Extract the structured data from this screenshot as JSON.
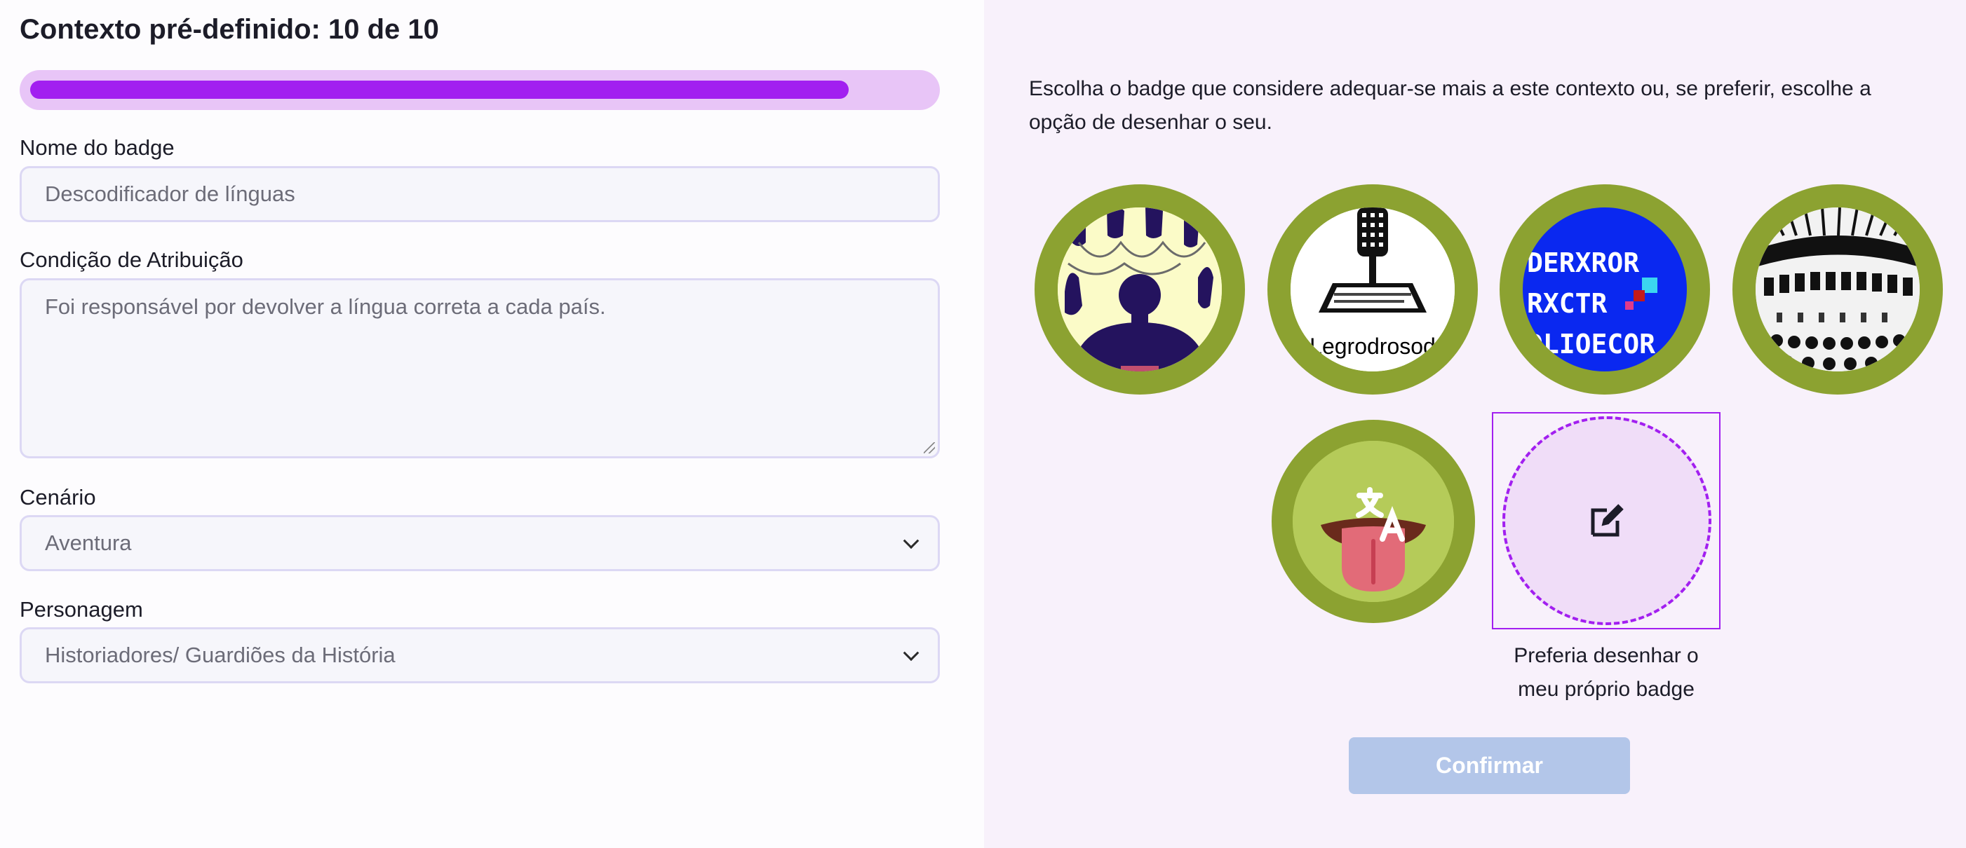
{
  "header": {
    "title": "Contexto pré-definido: 10 de 10"
  },
  "progress": {
    "fraction": 0.91,
    "color": "#a21ff0",
    "track_color": "#e8c5f7"
  },
  "form": {
    "badge_name": {
      "label": "Nome do badge",
      "placeholder": "Descodificador de línguas"
    },
    "condition": {
      "label": "Condição de Atribuição",
      "placeholder": "Foi responsável por devolver a língua correta a cada país."
    },
    "scenario": {
      "label": "Cenário",
      "value": "Aventura"
    },
    "character": {
      "label": "Personagem",
      "value": "Historiadores/ Guardiões da História"
    }
  },
  "panel": {
    "instructions": "Escolha o badge que considere adequar-se mais a este contexto ou, se preferir, escolhe a opção de desenhar o seu.",
    "badges": [
      {
        "name": "silhouette-brain-badge"
      },
      {
        "name": "microphone-stand-badge",
        "text": "Legrodrosod"
      },
      {
        "name": "blue-pixel-screen-badge",
        "lines": [
          "DERXROR",
          "RXCTR",
          "DLIOECOR"
        ]
      },
      {
        "name": "typewriter-keys-badge"
      },
      {
        "name": "tongue-translate-badge"
      }
    ],
    "own_badge": {
      "caption_line1": "Preferia desenhar o",
      "caption_line2": "meu próprio badge",
      "icon": "edit-icon"
    },
    "confirm_label": "Confirmar"
  },
  "colors": {
    "badge_ring": "#8ca231",
    "accent": "#a21ff0",
    "confirm_disabled": "#b3c6e9"
  }
}
